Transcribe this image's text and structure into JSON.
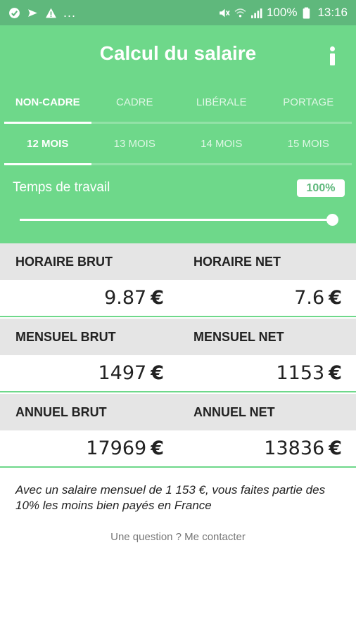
{
  "status_bar": {
    "battery": "100%",
    "time": "13:16",
    "dots": "...",
    "icons": [
      "checkbox-circle-icon",
      "paper-plane-icon",
      "warning-icon",
      "mute-icon",
      "wifi-icon",
      "signal-icon",
      "battery-icon"
    ]
  },
  "header": {
    "title": "Calcul du salaire",
    "info_icon": "info-icon",
    "tabs": [
      {
        "label": "NON-CADRE",
        "active": true
      },
      {
        "label": "CADRE",
        "active": false
      },
      {
        "label": "LIBÉRALE",
        "active": false
      },
      {
        "label": "PORTAGE",
        "active": false
      }
    ],
    "months": [
      {
        "label": "12 MOIS",
        "active": true
      },
      {
        "label": "13 MOIS",
        "active": false
      },
      {
        "label": "14 MOIS",
        "active": false
      },
      {
        "label": "15 MOIS",
        "active": false
      }
    ],
    "work_time_label": "Temps de travail",
    "work_time_value": "100%",
    "work_time_fraction": 1.0
  },
  "results": {
    "currency": "€",
    "rows": [
      {
        "brut_label": "HORAIRE BRUT",
        "net_label": "HORAIRE NET",
        "brut_value": "9.87",
        "net_value": "7.6"
      },
      {
        "brut_label": "MENSUEL BRUT",
        "net_label": "MENSUEL NET",
        "brut_value": "1497",
        "net_value": "1153"
      },
      {
        "brut_label": "ANNUEL BRUT",
        "net_label": "ANNUEL NET",
        "brut_value": "17969",
        "net_value": "13836"
      }
    ]
  },
  "summary": {
    "text": "Avec un salaire mensuel de 1 153 €, vous faites partie des 10% les moins bien payés en France"
  },
  "contact": {
    "text": "Une question ? Me contacter"
  },
  "colors": {
    "header_green": "#6ed88a",
    "status_green": "#5fb87c",
    "section_gray": "#e5e5e5"
  }
}
